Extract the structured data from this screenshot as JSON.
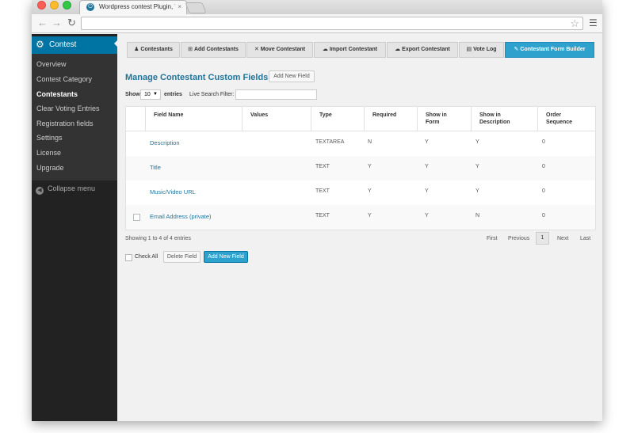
{
  "browser": {
    "tab_title": "Wordpress contest Plugin, W",
    "tab_close": "×",
    "url": ""
  },
  "sidebar": {
    "header": "Contest",
    "items": [
      {
        "label": "Overview"
      },
      {
        "label": "Contest Category"
      },
      {
        "label": "Contestants"
      },
      {
        "label": "Clear Voting Entries"
      },
      {
        "label": "Registration fields"
      },
      {
        "label": "Settings"
      },
      {
        "label": "License"
      },
      {
        "label": "Upgrade"
      }
    ],
    "active_item": "Contestants",
    "collapse_label": "Collapse menu"
  },
  "tabs": [
    {
      "label": "Contestants",
      "icon": "person-icon",
      "glyph": "♟"
    },
    {
      "label": "Add Contestants",
      "icon": "plus-square-icon",
      "glyph": "⊞"
    },
    {
      "label": "Move Contestant",
      "icon": "move-arrows-icon",
      "glyph": "✕"
    },
    {
      "label": "Import Contestant",
      "icon": "cloud-upload-icon",
      "glyph": "☁"
    },
    {
      "label": "Export Contestant",
      "icon": "cloud-download-icon",
      "glyph": "☁"
    },
    {
      "label": "Vote Log",
      "icon": "log-list-icon",
      "glyph": "▤"
    },
    {
      "label": "Contestant Form Builder",
      "icon": "edit-icon",
      "glyph": "✎"
    }
  ],
  "active_tab": "Contestant Form Builder",
  "page": {
    "title": "Manage Contestant Custom Fields",
    "add_new_label": "Add New Field",
    "show_label": "Show",
    "entries_value": "10",
    "entries_label": "entries",
    "search_label": "Live Search Filter:",
    "search_value": ""
  },
  "table": {
    "columns": [
      "Field Name",
      "Values",
      "Type",
      "Required",
      "Show in Form",
      "Show in Description",
      "Order Sequence"
    ],
    "rows": [
      {
        "name": "Description",
        "values": "",
        "type": "TEXTAREA",
        "required": "N",
        "show_form": "Y",
        "show_desc": "Y",
        "order": "0",
        "checkbox": false
      },
      {
        "name": "Title",
        "values": "",
        "type": "TEXT",
        "required": "Y",
        "show_form": "Y",
        "show_desc": "Y",
        "order": "0",
        "checkbox": false
      },
      {
        "name": "Music/Video URL",
        "values": "",
        "type": "TEXT",
        "required": "Y",
        "show_form": "Y",
        "show_desc": "Y",
        "order": "0",
        "checkbox": false
      },
      {
        "name": "Email Address (private)",
        "values": "",
        "type": "TEXT",
        "required": "Y",
        "show_form": "Y",
        "show_desc": "N",
        "order": "0",
        "checkbox": true
      }
    ]
  },
  "pagination": {
    "info": "Showing 1 to 4 of 4 entries",
    "first": "First",
    "previous": "Previous",
    "current": "1",
    "next": "Next",
    "last": "Last"
  },
  "footer": {
    "check_all": "Check All",
    "delete_label": "Delete Field",
    "add_label": "Add New Field"
  },
  "colors": {
    "wp_blue": "#0074a2",
    "accent": "#2ea2cc",
    "link": "#21759b",
    "sidebar_bg": "#222222"
  }
}
